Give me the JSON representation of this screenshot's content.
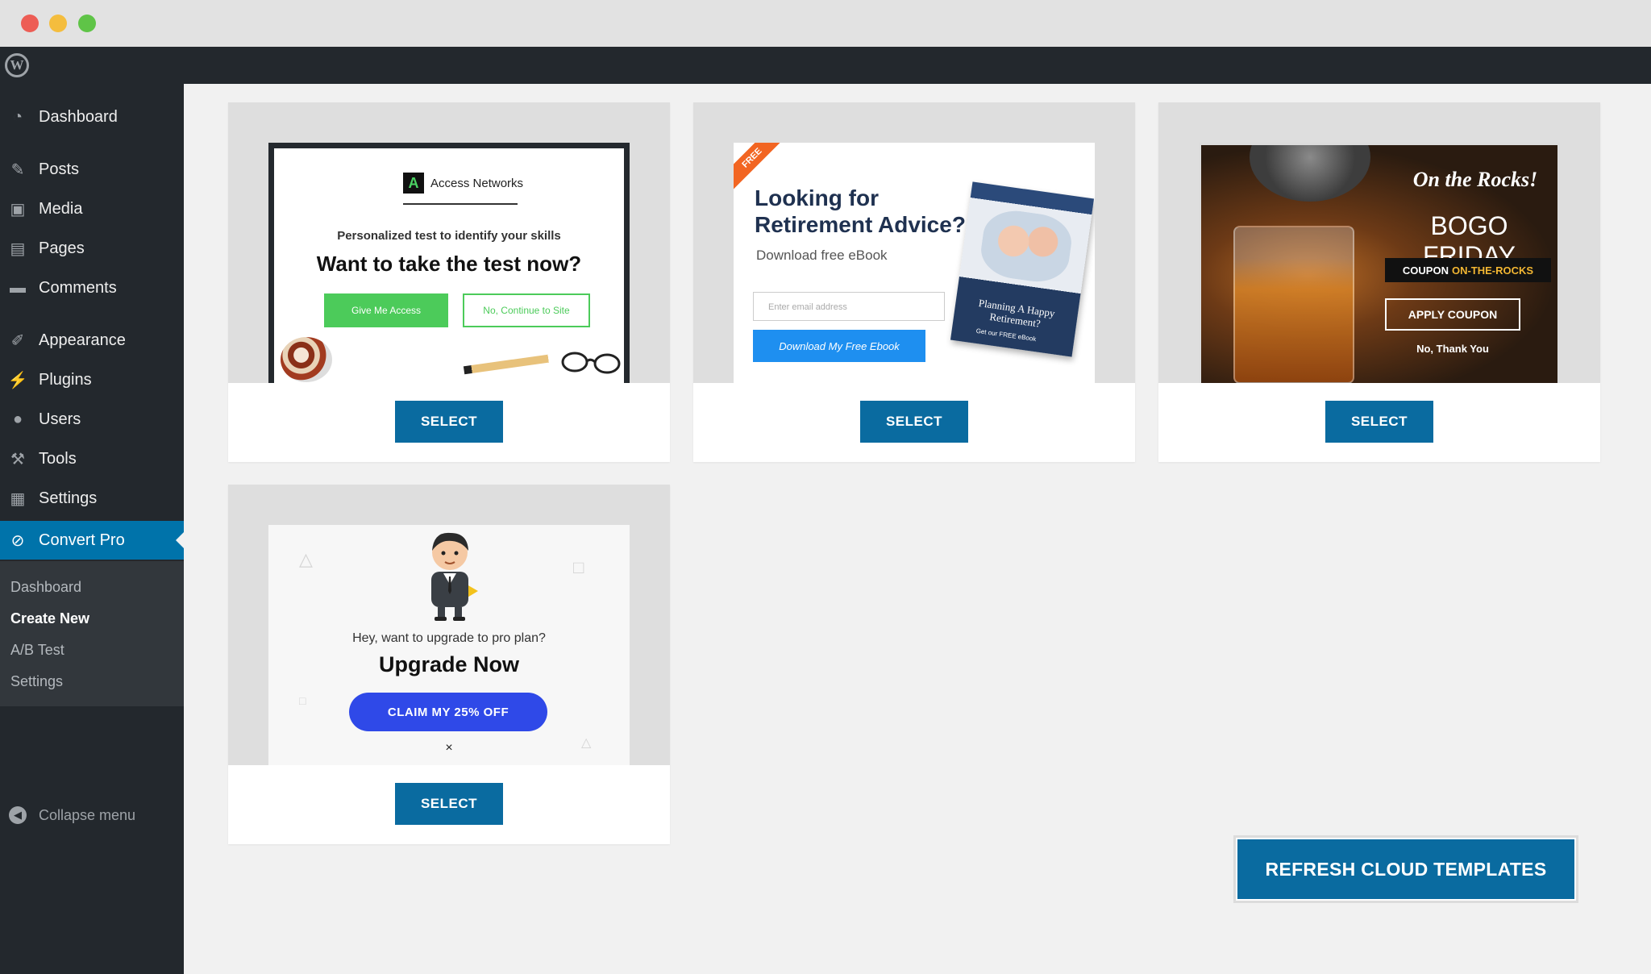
{
  "sidebar": {
    "items": [
      {
        "label": "Dashboard",
        "icon": "dashboard-icon"
      },
      {
        "label": "Posts",
        "icon": "pin-icon"
      },
      {
        "label": "Media",
        "icon": "media-icon"
      },
      {
        "label": "Pages",
        "icon": "page-icon"
      },
      {
        "label": "Comments",
        "icon": "comment-icon"
      },
      {
        "label": "Appearance",
        "icon": "brush-icon"
      },
      {
        "label": "Plugins",
        "icon": "plug-icon"
      },
      {
        "label": "Users",
        "icon": "user-icon"
      },
      {
        "label": "Tools",
        "icon": "wrench-icon"
      },
      {
        "label": "Settings",
        "icon": "settings-icon"
      },
      {
        "label": "Convert Pro",
        "icon": "convert-pro-icon",
        "active": true
      }
    ],
    "submenu": [
      "Dashboard",
      "Create New",
      "A/B Test",
      "Settings"
    ],
    "submenu_current": "Create New",
    "collapse_label": "Collapse menu"
  },
  "templates": [
    {
      "select_label": "SELECT",
      "logo": "Access Networks",
      "logo_mark": "A",
      "subtitle": "Personalized test to identify your skills",
      "headline": "Want to take the test now?",
      "primary": "Give Me Access",
      "secondary": "No, Continue to Site"
    },
    {
      "select_label": "SELECT",
      "ribbon": "FREE",
      "headline1": "Looking for",
      "headline2": "Retirement Advice?",
      "subline": "Download free eBook",
      "email_placeholder": "Enter email address",
      "button": "Download My Free Ebook",
      "book_title": "Planning A Happy Retirement?",
      "book_sub": "Get our FREE eBook"
    },
    {
      "select_label": "SELECT",
      "title": "On the Rocks!",
      "headline": "BOGO FRIDAY",
      "coupon_prefix": "COUPON",
      "coupon_code": "ON-THE-ROCKS",
      "apply": "APPLY COUPON",
      "dismiss": "No, Thank You"
    },
    {
      "select_label": "SELECT",
      "question": "Hey, want to upgrade to pro plan?",
      "headline": "Upgrade Now",
      "claim": "CLAIM  MY 25% OFF",
      "close": "×"
    }
  ],
  "refresh_label": "REFRESH CLOUD TEMPLATES",
  "colors": {
    "admin_dark": "#23282d",
    "wp_blue": "#0073aa",
    "button_blue": "#0a6ba0",
    "green": "#4ccb5a"
  }
}
